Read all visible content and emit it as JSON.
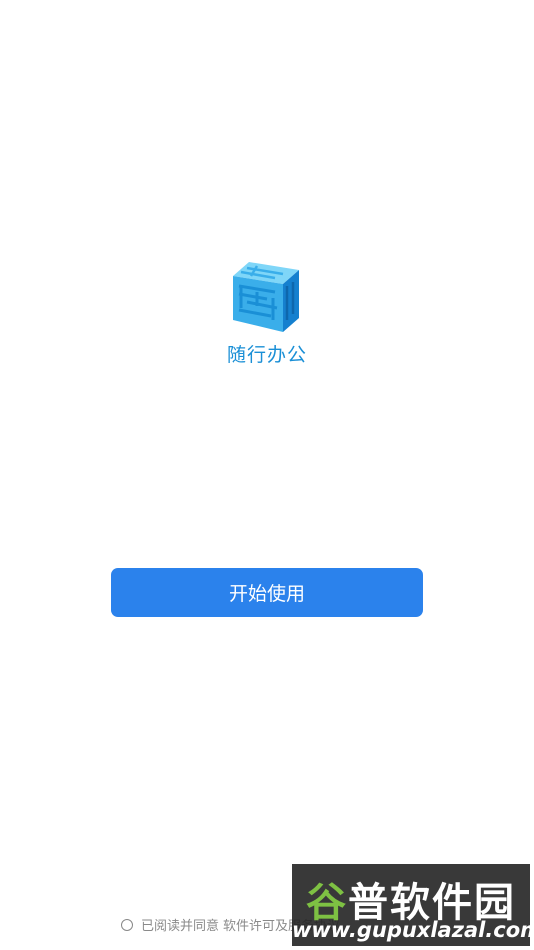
{
  "app": {
    "name": "随行办公"
  },
  "main": {
    "start_button_label": "开始使用"
  },
  "agreement": {
    "prefix": "已阅读并同意",
    "link_text": "软件许可及服务协议"
  },
  "watermark": {
    "title_first": "谷",
    "title_rest": "普软件园",
    "url": "www.gupuxlazal.com"
  },
  "colors": {
    "primary": "#2b82ec",
    "app_name": "#1a8fd6",
    "logo_light": "#5cc8f5",
    "logo_dark": "#1580cf",
    "watermark_accent": "#7ec143"
  },
  "icons": {
    "logo": "cube-logo-icon",
    "radio": "radio-unchecked-icon"
  }
}
